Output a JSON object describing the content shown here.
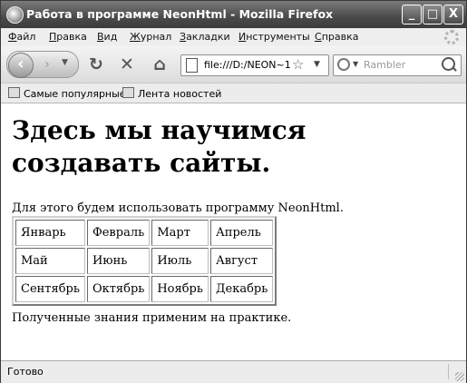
{
  "window": {
    "title": "Работа в программе NeonHtml - Mozilla Firefox",
    "controls": {
      "minimize": "_",
      "maximize": "□",
      "close": "X"
    }
  },
  "menubar": {
    "items": [
      {
        "label": "Файл",
        "accel": "Ф",
        "rest": "айл"
      },
      {
        "label": "Правка",
        "accel": "П",
        "rest": "равка"
      },
      {
        "label": "Вид",
        "accel": "В",
        "rest": "ид"
      },
      {
        "label": "Журнал",
        "accel": "Ж",
        "rest": "урнал"
      },
      {
        "label": "Закладки",
        "accel": "З",
        "rest": "акладки"
      },
      {
        "label": "Инструменты",
        "accel": "И",
        "rest": "нструменты"
      },
      {
        "label": "Справка",
        "accel": "С",
        "rest": "правка"
      }
    ]
  },
  "navbar": {
    "url": "file:///D:/NEON~1",
    "search_placeholder": "Rambler",
    "icons": [
      "back-icon",
      "forward-icon",
      "reload-icon",
      "stop-icon",
      "home-icon",
      "star-icon",
      "search-icon"
    ]
  },
  "bookmarks": {
    "items": [
      "Самые популярные",
      "Лента новостей"
    ]
  },
  "page": {
    "heading": "Здесь мы научимся создавать сайты.",
    "intro": "Для этого будем использовать программу NeonHtml.",
    "months": [
      [
        "Январь",
        "Февраль",
        "Март",
        "Апрель"
      ],
      [
        "Май",
        "Июнь",
        "Июль",
        "Август"
      ],
      [
        "Сентябрь",
        "Октябрь",
        "Ноябрь",
        "Декабрь"
      ]
    ],
    "outro": "Полученные знания применим на практике."
  },
  "status": {
    "text": "Готово"
  }
}
